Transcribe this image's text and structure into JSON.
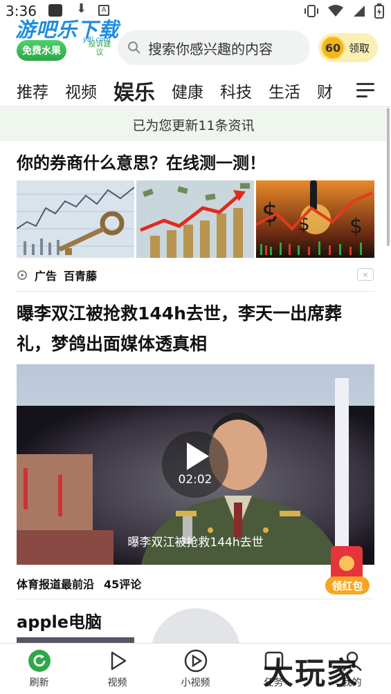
{
  "status_bar": {
    "time": "3:36"
  },
  "header": {
    "logo_text": "游吧乐下载",
    "logo_sub": "y8l.com",
    "free_fruit_label": "免费水果",
    "feedback_label": "投诉建议",
    "search_placeholder": "搜索你感兴趣的内容",
    "coin_value": "60",
    "claim_label": "领取"
  },
  "tabs": [
    "推荐",
    "视频",
    "娱乐",
    "健康",
    "科技",
    "生活",
    "财"
  ],
  "active_tab": "娱乐",
  "update_banner": "已为您更新11条资讯",
  "ad": {
    "title": "你的券商什么意思？在线测一测！",
    "ad_label": "广告",
    "source": "百青藤",
    "close_label": "×"
  },
  "article": {
    "title": "曝李双江被抢救144h去世，李天一出席葬礼，梦鸽出面媒体透真相",
    "video_duration": "02:02",
    "video_caption": "曝李双江被抢救144h去世",
    "source": "体育报道最前沿",
    "comments": "45评论"
  },
  "red_packet_label": "领红包",
  "second_article": {
    "title": "apple电脑"
  },
  "bottom_nav": [
    {
      "label": "刷新",
      "icon": "refresh-icon"
    },
    {
      "label": "视频",
      "icon": "video-play-icon"
    },
    {
      "label": "小视频",
      "icon": "short-video-icon"
    },
    {
      "label": "任务",
      "icon": "task-icon"
    },
    {
      "label": "我的",
      "icon": "profile-icon"
    }
  ],
  "watermark": "大玩家",
  "colors": {
    "brand_green": "#2ea84a",
    "logo_blue": "#1f8de0",
    "banner_bg": "#eef6ee",
    "coin_gold": "#f6b417"
  }
}
